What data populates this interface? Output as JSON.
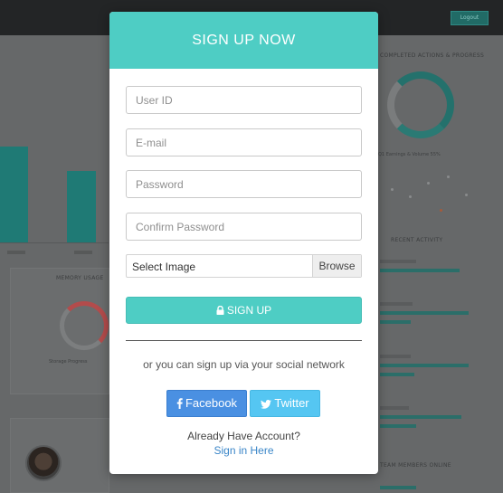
{
  "background": {
    "topbar_button": "Logout",
    "right_panel_title": "Completed Actions & Progress",
    "earnings_caption": "Q1 Earnings & Volume 55%",
    "recent_activity_title": "Recent Activity",
    "memory_panel_title": "Memory Usage",
    "storage_caption": "Storage Progress",
    "team_title": "Team Members Online",
    "colors": {
      "teal": "#1f7a75",
      "red": "#c44b4b"
    }
  },
  "modal": {
    "title": "SIGN UP NOW",
    "fields": {
      "user_id_placeholder": "User ID",
      "email_placeholder": "E-mail",
      "password_placeholder": "Password",
      "confirm_password_placeholder": "Confirm Password"
    },
    "file": {
      "label": "Select Image",
      "browse": "Browse"
    },
    "submit_label": "SIGN UP",
    "social_prompt": "or you can sign up via your social network",
    "facebook_label": "Facebook",
    "twitter_label": "Twitter",
    "already_text": "Already Have Account?",
    "signin_text": "Sign in Here",
    "colors": {
      "accent": "#4ecdc4",
      "facebook": "#4a90e2",
      "twitter": "#55c6f2",
      "link": "#3a86c8"
    },
    "icons": {
      "submit": "lock-icon",
      "facebook": "facebook-icon",
      "twitter": "twitter-icon"
    }
  }
}
